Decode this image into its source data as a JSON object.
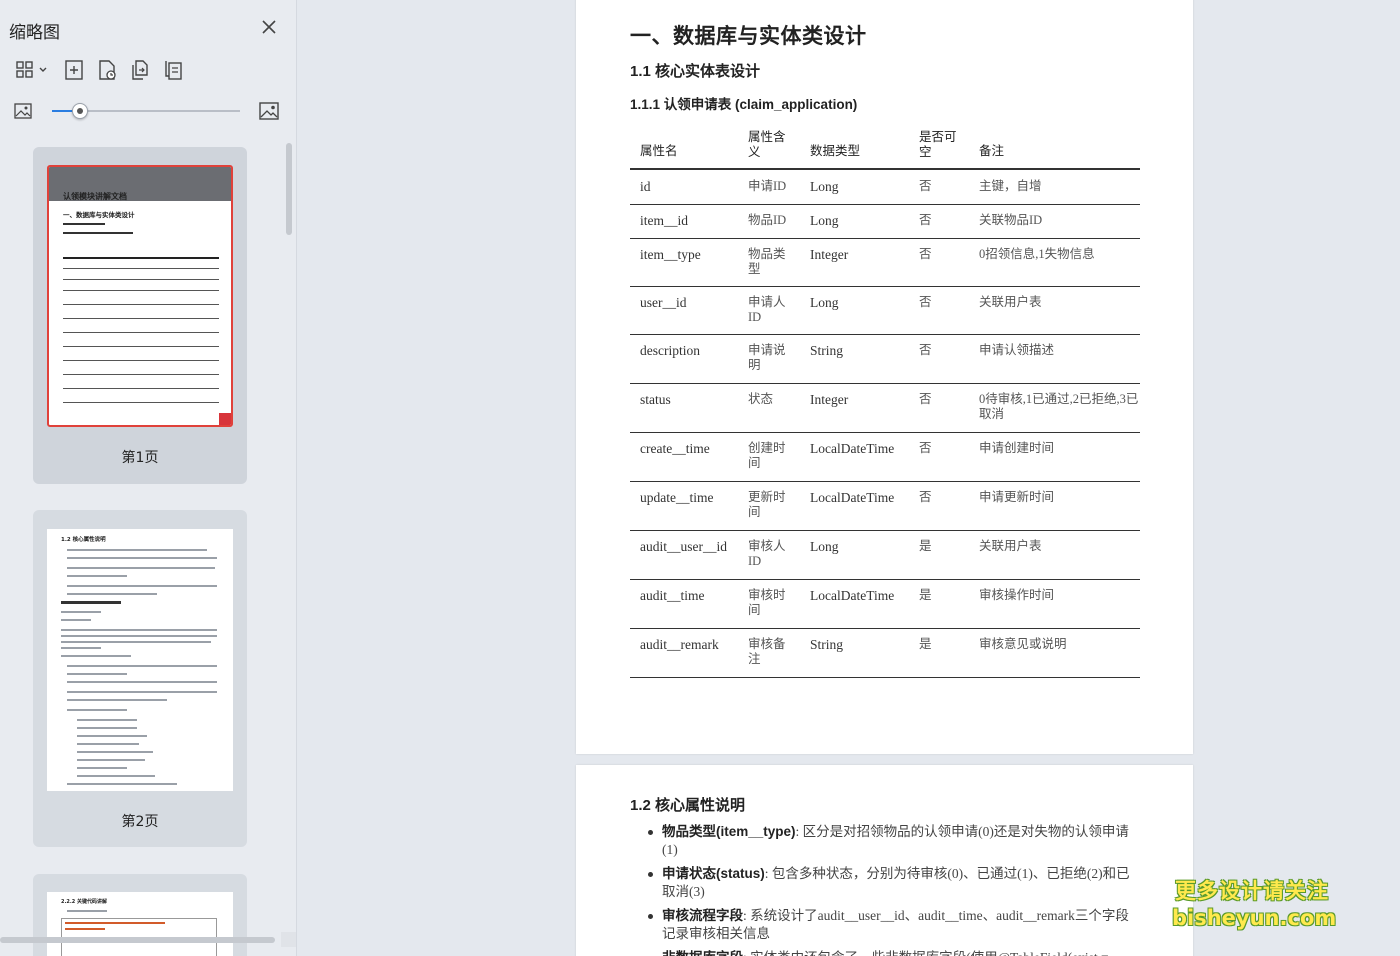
{
  "sidebar": {
    "title": "缩略图",
    "toolbar_icons": [
      "thumbnail-layout-icon",
      "insert-page-icon",
      "insert-from-file-icon",
      "copy-page-icon",
      "paste-page-icon"
    ],
    "zoom_level": 0.15,
    "thumbnails": [
      {
        "label": "第1页",
        "banner": "认领模块讲解文档",
        "heading": "一、数据库与实体类设计"
      },
      {
        "label": "第2页",
        "heading": "1.2 核心属性说明"
      },
      {
        "label": "",
        "heading": "2.2.2 关键代码讲解"
      }
    ]
  },
  "doc": {
    "page1": {
      "h1": "一、数据库与实体类设计",
      "h2": "1.1 核心实体表设计",
      "h3": "1.1.1 认领申请表 (claim_application)",
      "columns": [
        "属性名",
        "属性含义",
        "数据类型",
        "是否可空",
        "备注"
      ],
      "rows": [
        {
          "name": "id",
          "meaning": "申请ID",
          "type": "Long",
          "nullable": "否",
          "note": "主键，自增"
        },
        {
          "name": "item__id",
          "meaning": "物品ID",
          "type": "Long",
          "nullable": "否",
          "note": "关联物品ID"
        },
        {
          "name": "item__type",
          "meaning": "物品类型",
          "type": "Integer",
          "nullable": "否",
          "note": "0招领信息,1失物信息"
        },
        {
          "name": "user__id",
          "meaning": "申请人ID",
          "type": "Long",
          "nullable": "否",
          "note": "关联用户表"
        },
        {
          "name": "description",
          "meaning": "申请说明",
          "type": "String",
          "nullable": "否",
          "note": "申请认领描述"
        },
        {
          "name": "status",
          "meaning": "状态",
          "type": "Integer",
          "nullable": "否",
          "note": "0待审核,1已通过,2已拒绝,3已取消"
        },
        {
          "name": "create__time",
          "meaning": "创建时间",
          "type": "LocalDateTime",
          "nullable": "否",
          "note": "申请创建时间"
        },
        {
          "name": "update__time",
          "meaning": "更新时间",
          "type": "LocalDateTime",
          "nullable": "否",
          "note": "申请更新时间"
        },
        {
          "name": "audit__user__id",
          "meaning": "审核人ID",
          "type": "Long",
          "nullable": "是",
          "note": "关联用户表"
        },
        {
          "name": "audit__time",
          "meaning": "审核时间",
          "type": "LocalDateTime",
          "nullable": "是",
          "note": "审核操作时间"
        },
        {
          "name": "audit__remark",
          "meaning": "审核备注",
          "type": "String",
          "nullable": "是",
          "note": "审核意见或说明"
        }
      ]
    },
    "page2": {
      "h2": "1.2 核心属性说明",
      "bullets": [
        {
          "bold": "物品类型(item__type)",
          "text": ": 区分是对招领物品的认领申请(0)还是对失物的认领申请(1)"
        },
        {
          "bold": "申请状态(status)",
          "text": ": 包含多种状态，分别为待审核(0)、已通过(1)、已拒绝(2)和已取消(3)"
        },
        {
          "bold": "审核流程字段",
          "text": ": 系统设计了audit__user__id、audit__time、audit__remark三个字段记录审核相关信息"
        },
        {
          "bold": "非数据库字段",
          "text": ": 实体类中还包含了一些非数据库字段(使用@TableField(exist ="
        }
      ]
    }
  },
  "watermark": {
    "line1": "更多设计请关注",
    "line2": "bisheyun.com"
  },
  "colors": {
    "accent": "#2a7de1",
    "selected_border": "#e0413a",
    "watermark": "#ffe94d"
  }
}
